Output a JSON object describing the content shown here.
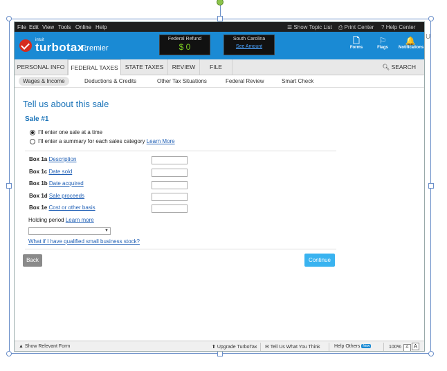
{
  "menu": [
    "File",
    "Edit",
    "View",
    "Tools",
    "Online",
    "Help"
  ],
  "toolbar": {
    "show_topic_list": "Show Topic List",
    "print_center": "Print Center",
    "help_center": "Help Center"
  },
  "header": {
    "intuit": "intuit",
    "brand": "turbotax.",
    "edition": "Premier",
    "federal_refund_label": "Federal Refund",
    "federal_refund_amount": "$ 0",
    "state_label": "South Carolina",
    "state_link": "See Amount",
    "icons": [
      {
        "label": "Forms",
        "icon": "forms-icon"
      },
      {
        "label": "Flags",
        "icon": "flag-icon"
      },
      {
        "label": "Notifications",
        "icon": "bell-icon"
      }
    ]
  },
  "nav": {
    "tabs": [
      "PERSONAL INFO",
      "FEDERAL TAXES",
      "STATE TAXES",
      "REVIEW",
      "FILE"
    ],
    "active": "FEDERAL TAXES",
    "search": "SEARCH"
  },
  "subnav": {
    "tabs": [
      "Wages & Income",
      "Deductions & Credits",
      "Other Tax Situations",
      "Federal Review",
      "Smart Check"
    ],
    "active": "Wages & Income"
  },
  "main": {
    "title": "Tell us about this sale",
    "sale_title": "Sale #1",
    "option_one": "I'll enter one sale at a time",
    "option_summary": "I'll enter a summary for each sales category",
    "learn_more": "Learn More",
    "boxes": [
      {
        "box": "Box 1a",
        "link": "Description",
        "value": ""
      },
      {
        "box": "Box 1c",
        "link": "Date sold",
        "value": ""
      },
      {
        "box": "Box 1b",
        "link": "Date acquired",
        "value": ""
      },
      {
        "box": "Box 1d",
        "link": "Sale proceeds",
        "value": ""
      },
      {
        "box": "Box 1e",
        "link": "Cost or other basis",
        "value": ""
      }
    ],
    "holding_period_label": "Holding period",
    "holding_period_link": "Learn more",
    "holding_period_value": "",
    "qsbs_link": "What if I have qualified small business stock?",
    "back": "Back",
    "continue": "Continue"
  },
  "status_bar": {
    "show_relevant_form": "Show Relevant Form",
    "upgrade": "Upgrade TurboTax",
    "tell_us": "Tell Us What You Think",
    "help_others": "Help Others",
    "new_badge": "New",
    "zoom": "100%",
    "font_small": "A",
    "font_large": "A"
  },
  "peek_text": "U"
}
